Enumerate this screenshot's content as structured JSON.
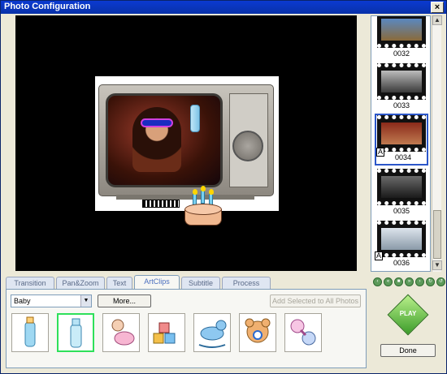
{
  "window": {
    "title": "Photo Configuration",
    "close_label": "×"
  },
  "thumbnails": [
    {
      "number": "0032",
      "badge": ""
    },
    {
      "number": "0033",
      "badge": ""
    },
    {
      "number": "0034",
      "badge": "A"
    },
    {
      "number": "0035",
      "badge": ""
    },
    {
      "number": "0036",
      "badge": "A"
    }
  ],
  "selected_thumbnail": "0034",
  "scrollbar": {
    "up": "▲",
    "down": "▼"
  },
  "tabs": [
    "Transition",
    "Pan&Zoom",
    "Text",
    "ArtClips",
    "Subtitle",
    "Process"
  ],
  "active_tab": "ArtClips",
  "artclips": {
    "category": "Baby",
    "category_arrow": "▼",
    "more_label": "More...",
    "add_all_label": "Add Selected to All Photos",
    "items": [
      "baby-bottle",
      "baby-bottle-selected",
      "baby-crawling",
      "toy-blocks",
      "rocking-horse",
      "teddy-bear",
      "baby-rattle"
    ]
  },
  "nav_icons": [
    "‹",
    "«",
    "■",
    "»",
    "›",
    "↻",
    "↺"
  ],
  "play_label": "PLAY",
  "done_label": "Done"
}
